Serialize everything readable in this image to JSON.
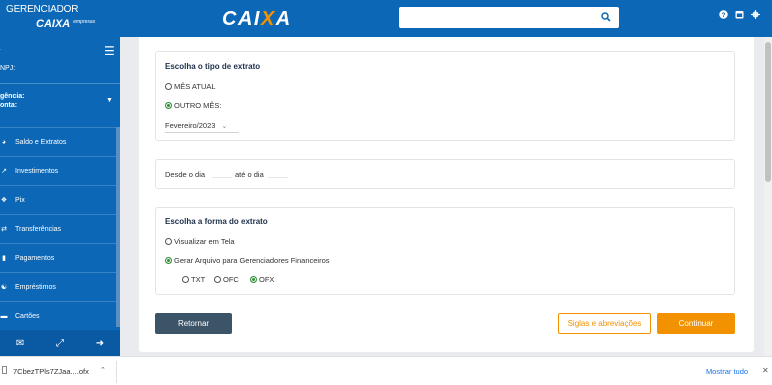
{
  "header": {
    "brand_line1": "GERENCIADOR",
    "brand_line2": "CAIXA",
    "brand_line3": "empresas",
    "logo_left": "CAI",
    "logo_accent": "X",
    "logo_right": "A",
    "search_value": "",
    "search_icon": "search-icon",
    "icons": [
      "help-icon",
      "calendar-icon",
      "gear-icon"
    ]
  },
  "sidebar": {
    "cnpj_label": "NPJ:",
    "agency_label": "gência:",
    "account_label": "onta:",
    "items": [
      {
        "icon": "chart-pie-icon",
        "label": "Saldo e Extratos"
      },
      {
        "icon": "trend-line-icon",
        "label": "Investimentos"
      },
      {
        "icon": "pix-icon",
        "label": "Pix"
      },
      {
        "icon": "transfer-arrows-icon",
        "label": "Transferências"
      },
      {
        "icon": "barcode-icon",
        "label": "Pagamentos"
      },
      {
        "icon": "hand-money-icon",
        "label": "Empréstimos"
      },
      {
        "icon": "card-icon",
        "label": "Cartões"
      }
    ],
    "bottom_icons": [
      "mail-icon",
      "fullscreen-icon",
      "logout-icon"
    ]
  },
  "extract_type": {
    "title": "Escolha o tipo de extrato",
    "option_current": "MÊS ATUAL",
    "option_other": "OUTRO MÊS:",
    "selected": "OUTRO MÊS:",
    "month_value": "Fevereiro/2023"
  },
  "date_range": {
    "from_label": "Desde o dia",
    "to_label": "até o dia",
    "from_value": "",
    "to_value": ""
  },
  "extract_form": {
    "title": "Escolha a forma do extrato",
    "option_screen": "Visualizar em Tela",
    "option_file": "Gerar Arquivo para Gerenciadores Financeiros",
    "selected": "Gerar Arquivo para Gerenciadores Financeiros",
    "formats": [
      "TXT",
      "OFC",
      "OFX"
    ],
    "selected_format": "OFX"
  },
  "buttons": {
    "back": "Retornar",
    "abbreviations": "Siglas e abreviações",
    "continue": "Continuar"
  },
  "download_bar": {
    "file_name": "7CbezTPls7ZJaa....ofx",
    "show_all": "Mostrar tudo"
  },
  "colors": {
    "primary": "#0c67b6",
    "accent": "#f39200",
    "dark_button": "#3b5468",
    "selected_radio": "#2f8f36"
  }
}
